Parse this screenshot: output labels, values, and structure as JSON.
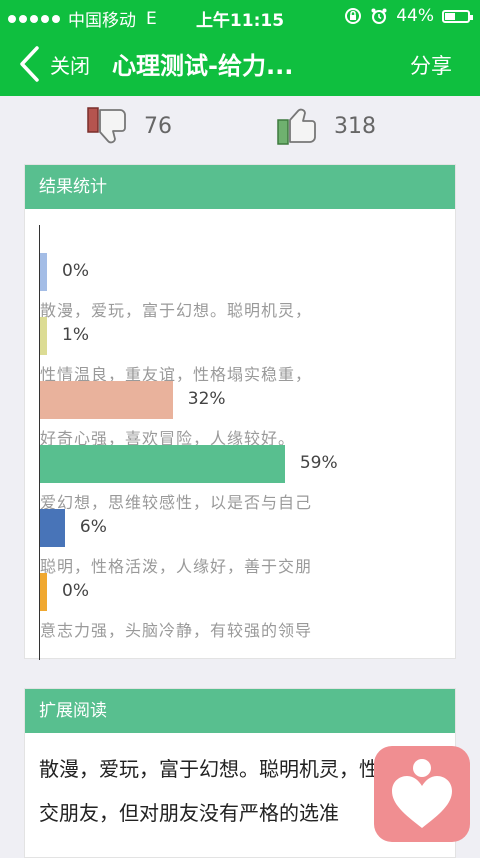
{
  "status_bar": {
    "carrier": "中国移动",
    "network": "E",
    "time": "上午11:15",
    "battery": "44%",
    "battery_level": 0.44
  },
  "nav": {
    "close_label": "关闭",
    "title": "心理测试-给力...",
    "share_label": "分享"
  },
  "votes": {
    "dislike_count": "76",
    "like_count": "318"
  },
  "stats": {
    "header": "结果统计",
    "accent_header_color": "#58bf8f"
  },
  "chart_data": {
    "type": "bar",
    "orientation": "horizontal",
    "xlim": [
      0,
      100
    ],
    "items": [
      {
        "label": "散漫，爱玩，富于幻想。聪明机灵，",
        "value": 0,
        "value_label": "0%",
        "color": "#a4bde6"
      },
      {
        "label": "性情温良，重友谊，性格塌实稳重，",
        "value": 1,
        "value_label": "1%",
        "color": "#dcdc94"
      },
      {
        "label": "好奇心强，喜欢冒险，人缘较好。",
        "value": 32,
        "value_label": "32%",
        "color": "#e9b29c"
      },
      {
        "label": "爱幻想，思维较感性，以是否与自己",
        "value": 59,
        "value_label": "59%",
        "color": "#58bf8f"
      },
      {
        "label": "聪明，性格活泼，人缘好，善于交朋",
        "value": 6,
        "value_label": "6%",
        "color": "#4874b8"
      },
      {
        "label": "意志力强，头脑冷静，有较强的领导",
        "value": 0,
        "value_label": "0%",
        "color": "#f0a830"
      }
    ]
  },
  "extended": {
    "header": "扩展阅读",
    "text": "散漫，爱玩，富于幻想。聪明机灵，性情，爱交朋友，但对朋友没有严格的选准"
  },
  "colors": {
    "nav_green": "#0fbf3f",
    "fab_pink": "#f08e91"
  }
}
